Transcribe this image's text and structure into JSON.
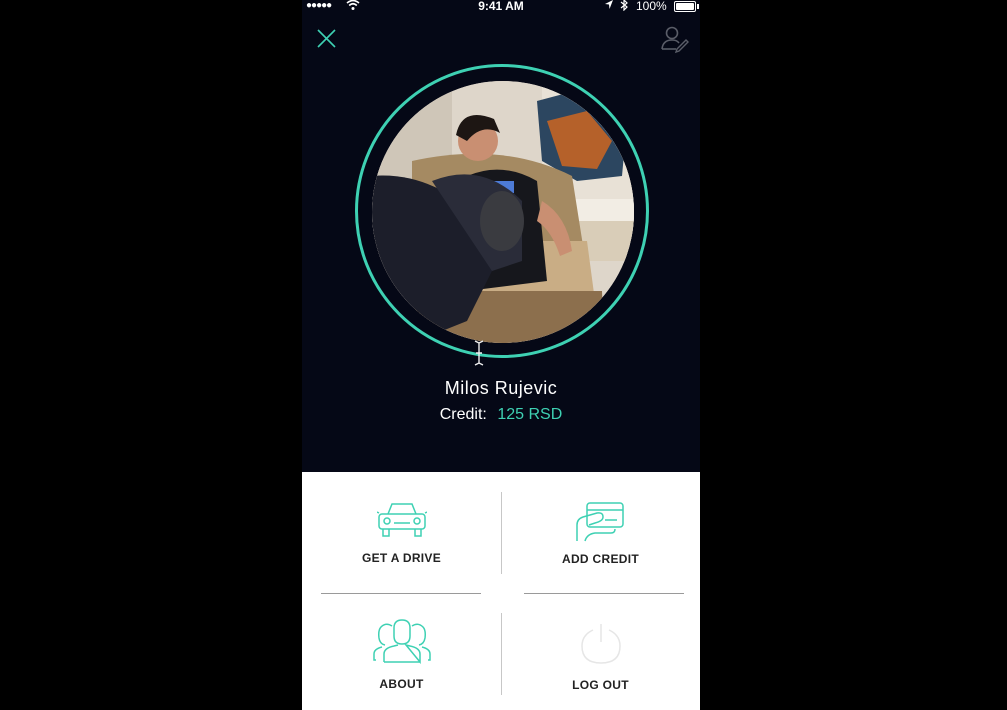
{
  "status_bar": {
    "signal": "●●●●●",
    "time": "9:41 AM",
    "battery": "100%"
  },
  "header": {
    "close_icon": "close-icon",
    "profile_icon": "user-edit-icon"
  },
  "profile": {
    "name": "Milos Rujevic",
    "credit_label": "Credit:",
    "credit_value": "125 RSD"
  },
  "menu": {
    "items": [
      {
        "label": "GET A DRIVE",
        "icon": "car-icon"
      },
      {
        "label": "ADD CREDIT",
        "icon": "credit-card-icon"
      },
      {
        "label": "ABOUT",
        "icon": "users-icon"
      },
      {
        "label": "LOG OUT",
        "icon": "power-icon"
      }
    ]
  },
  "colors": {
    "accent": "#3ed1b3",
    "background": "#050816",
    "menu_bg": "#ffffff"
  }
}
